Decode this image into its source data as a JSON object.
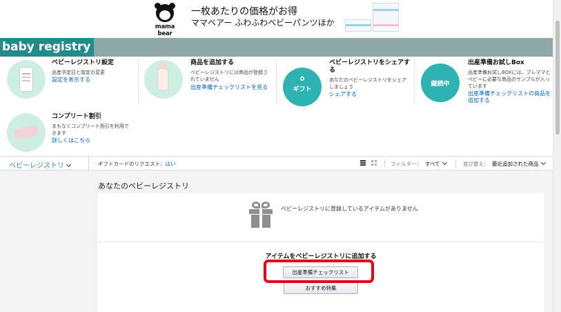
{
  "banner": {
    "logo_text": "mama bear",
    "line1": "一枚あたりの価格がお得",
    "line2": "ママベアー ふわふわベビーパンツほか"
  },
  "header": {
    "title": "baby registry"
  },
  "cards": [
    {
      "title": "ベビーレジストリ設定",
      "desc": "出産予定日と設定の変更",
      "link": "設定を表示する"
    },
    {
      "title": "商品を追加する",
      "desc": "ベビーレジストリには商品が登録されていません",
      "link": "出産準備チェックリストを見る"
    },
    {
      "title": "ベビーレジストリをシェアする",
      "desc": "あなたのベビーレジストリをシェアしましょう",
      "link": "シェアする",
      "badge_number": "0",
      "badge_label": "ギフト"
    },
    {
      "title": "出産準備お試しBox",
      "desc": "出産準備お試しBOXには、プレママとベビーに必要な商品のサンプルが入っています",
      "link": "出産準備チェックリストの商品を追加する",
      "badge_label": "継続中"
    },
    {
      "title": "コンプリート割引",
      "desc": "まもなくコンプリート割引を利用できます",
      "link": "詳しくはこちら"
    }
  ],
  "filter_bar": {
    "registry_dropdown": "ベビーレジストリ",
    "gift_card_label": "ギフトカードのリクエスト：",
    "gift_card_value": "はい",
    "filter_label": "フィルター：",
    "filter_value": "すべて",
    "sort_label": "並び替え：",
    "sort_value": "最近追加された商品"
  },
  "main": {
    "section_title": "あなたのベビーレジストリ",
    "empty_message": "ベビーレジストリに登録しているアイテムがありません",
    "add_title": "アイテムをベビーレジストリに追加する",
    "checklist_button": "出産準備チェックリスト",
    "recommend_button": "おすすめ特集"
  },
  "colors": {
    "teal": "#248b8b",
    "header_gray_teal": "#8ea7a8",
    "link_blue": "#0066c0",
    "highlight_red": "#e3001b"
  }
}
